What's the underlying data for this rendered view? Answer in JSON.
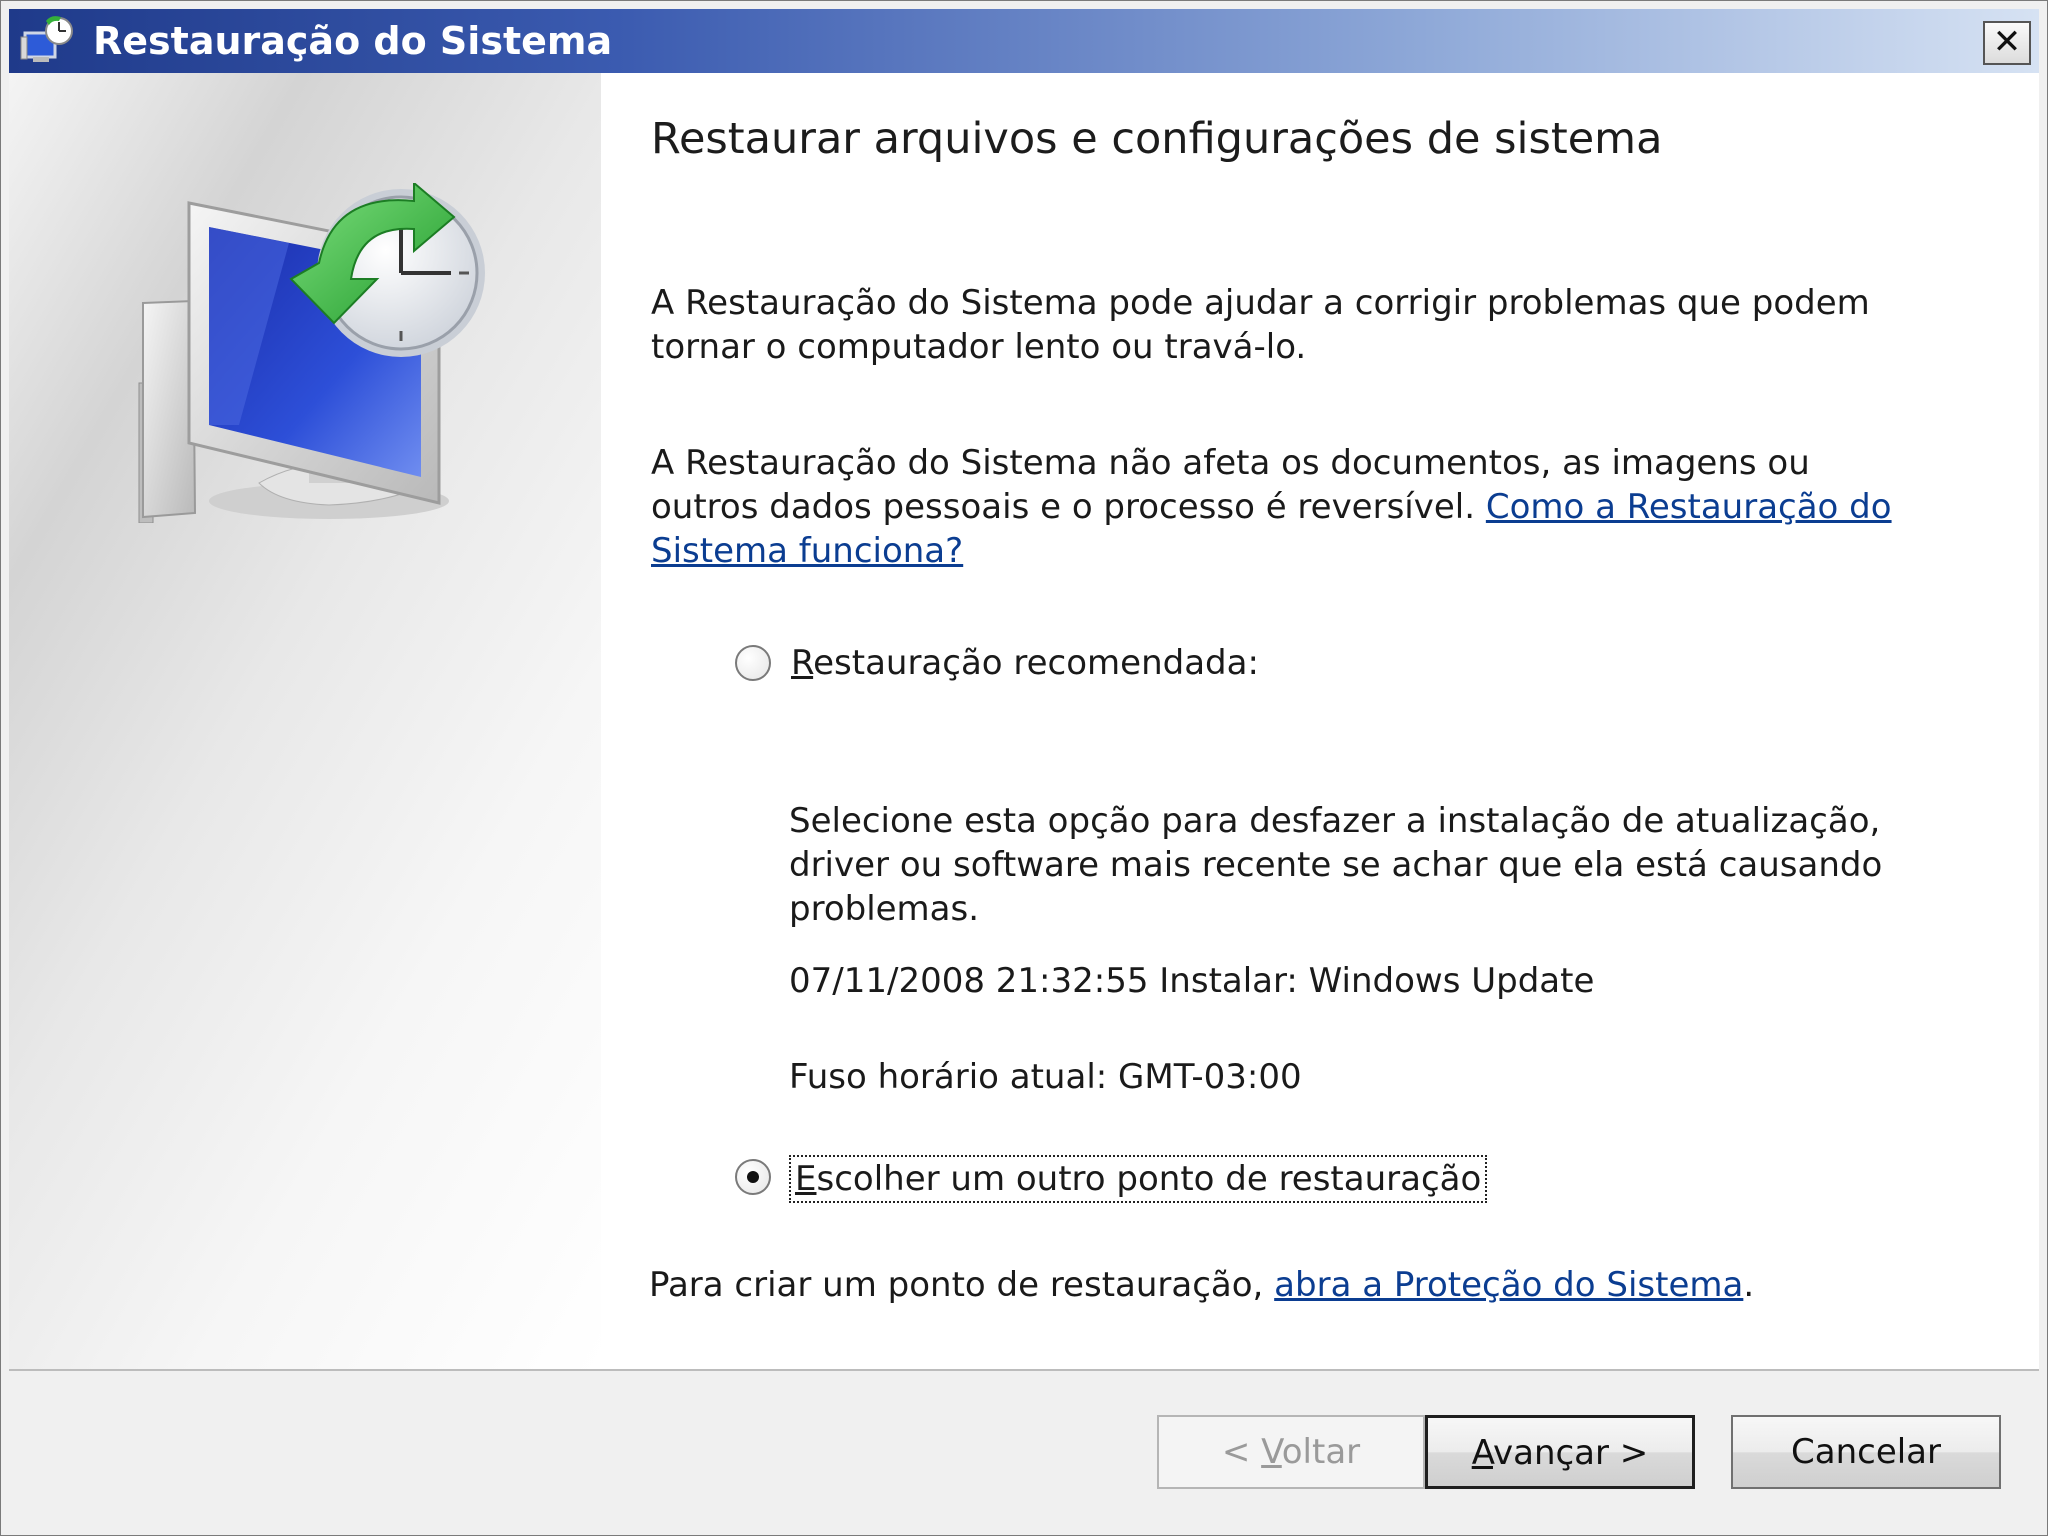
{
  "window": {
    "title": "Restauração do Sistema",
    "close_label": "✕"
  },
  "content": {
    "heading": "Restaurar arquivos e configurações de sistema",
    "paragraph1": "A Restauração do Sistema pode ajudar a corrigir problemas que podem tornar o computador lento ou travá-lo.",
    "paragraph2_text": "A Restauração do Sistema não afeta os documentos, as imagens ou outros dados pessoais e o processo é reversível.",
    "paragraph2_link": "Como a Restauração do Sistema funciona?",
    "option_recommended": {
      "label_first": "R",
      "label_rest": "estauração recomendada:",
      "selected": false,
      "description": "Selecione esta opção para desfazer a instalação de atualização, driver ou software mais recente se achar que ela está causando problemas.",
      "update_info": "07/11/2008 21:32:55 Instalar: Windows Update",
      "timezone": "Fuso horário atual: GMT-03:00"
    },
    "option_other": {
      "label_first": "E",
      "label_rest": "scolher um outro ponto de restauração",
      "selected": true
    },
    "paragraph3_text": "Para criar um ponto de restauração,",
    "paragraph3_link": "abra a Proteção do Sistema",
    "paragraph3_end": "."
  },
  "buttons": {
    "back_prefix": "< ",
    "back_accel": "V",
    "back_rest": "oltar",
    "next_accel": "A",
    "next_rest": "vançar >",
    "cancel": "Cancelar"
  },
  "colors": {
    "link": "#0b3d91",
    "titlebar_start": "#1f3a8a",
    "titlebar_end": "#d6e2f3"
  }
}
